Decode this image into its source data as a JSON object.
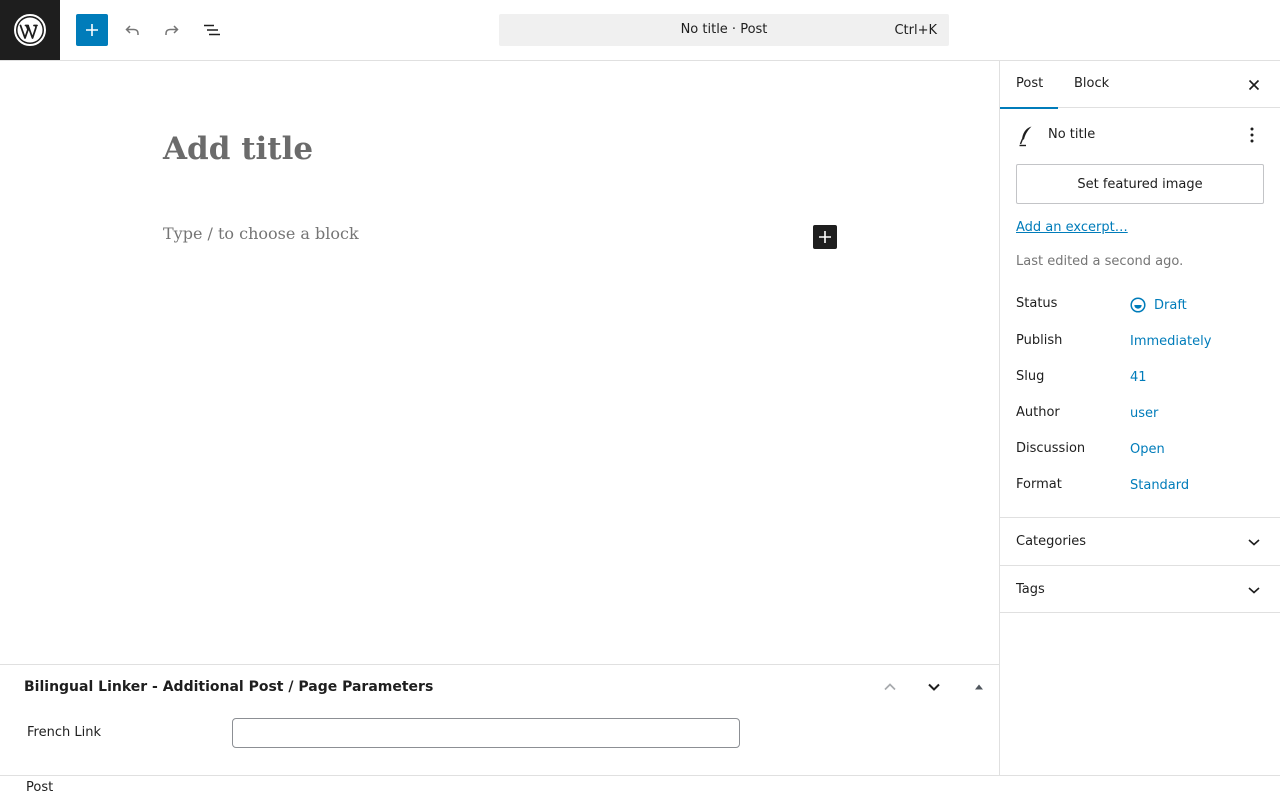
{
  "toolbar": {
    "logo_icon": "wordpress-logo",
    "add_icon": "plus-icon",
    "undo_icon": "undo-icon",
    "redo_icon": "redo-icon",
    "listview_icon": "list-view-icon",
    "document_title": "No title · Post",
    "shortcut": "Ctrl+K"
  },
  "editor": {
    "title_placeholder": "Add title",
    "block_placeholder": "Type / to choose a block",
    "inline_add_icon": "plus-icon"
  },
  "metabox": {
    "title": "Bilingual Linker - Additional Post / Page Parameters",
    "field_label": "French Link",
    "field_value": "",
    "field_placeholder": ""
  },
  "footer": {
    "breadcrumb": "Post"
  },
  "sidebar": {
    "tabs": [
      {
        "label": "Post",
        "active": true
      },
      {
        "label": "Block",
        "active": false
      }
    ],
    "post_name": "No title",
    "featured_image_label": "Set featured image",
    "excerpt_link": "Add an excerpt…",
    "last_edited": "Last edited a second ago.",
    "rows": [
      {
        "label": "Status",
        "value": "Draft"
      },
      {
        "label": "Publish",
        "value": "Immediately"
      },
      {
        "label": "Slug",
        "value": "41"
      },
      {
        "label": "Author",
        "value": "user"
      },
      {
        "label": "Discussion",
        "value": "Open"
      },
      {
        "label": "Format",
        "value": "Standard"
      }
    ],
    "panels": [
      {
        "label": "Categories"
      },
      {
        "label": "Tags"
      }
    ]
  },
  "colors": {
    "accent": "#007cba",
    "dark": "#1e1e1e",
    "muted": "#757575",
    "border": "#e0e0e0"
  }
}
